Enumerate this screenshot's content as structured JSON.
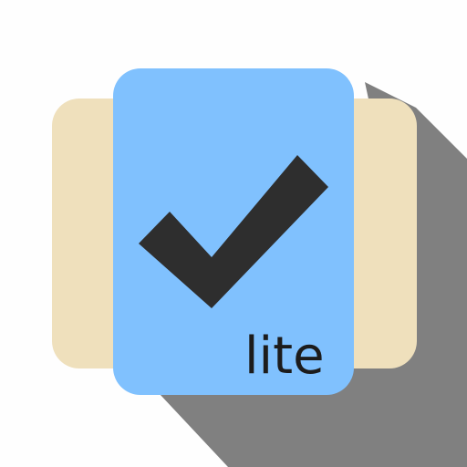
{
  "app_icon": {
    "badge": "lite",
    "glyph": "checkmark-icon",
    "colors": {
      "background": "#fefefe",
      "shadow": "#808080",
      "back_card": "#efe0bc",
      "front_card": "#80c1fe",
      "checkmark": "#2e2e2e",
      "badge_text": "#1c1c1c"
    }
  }
}
